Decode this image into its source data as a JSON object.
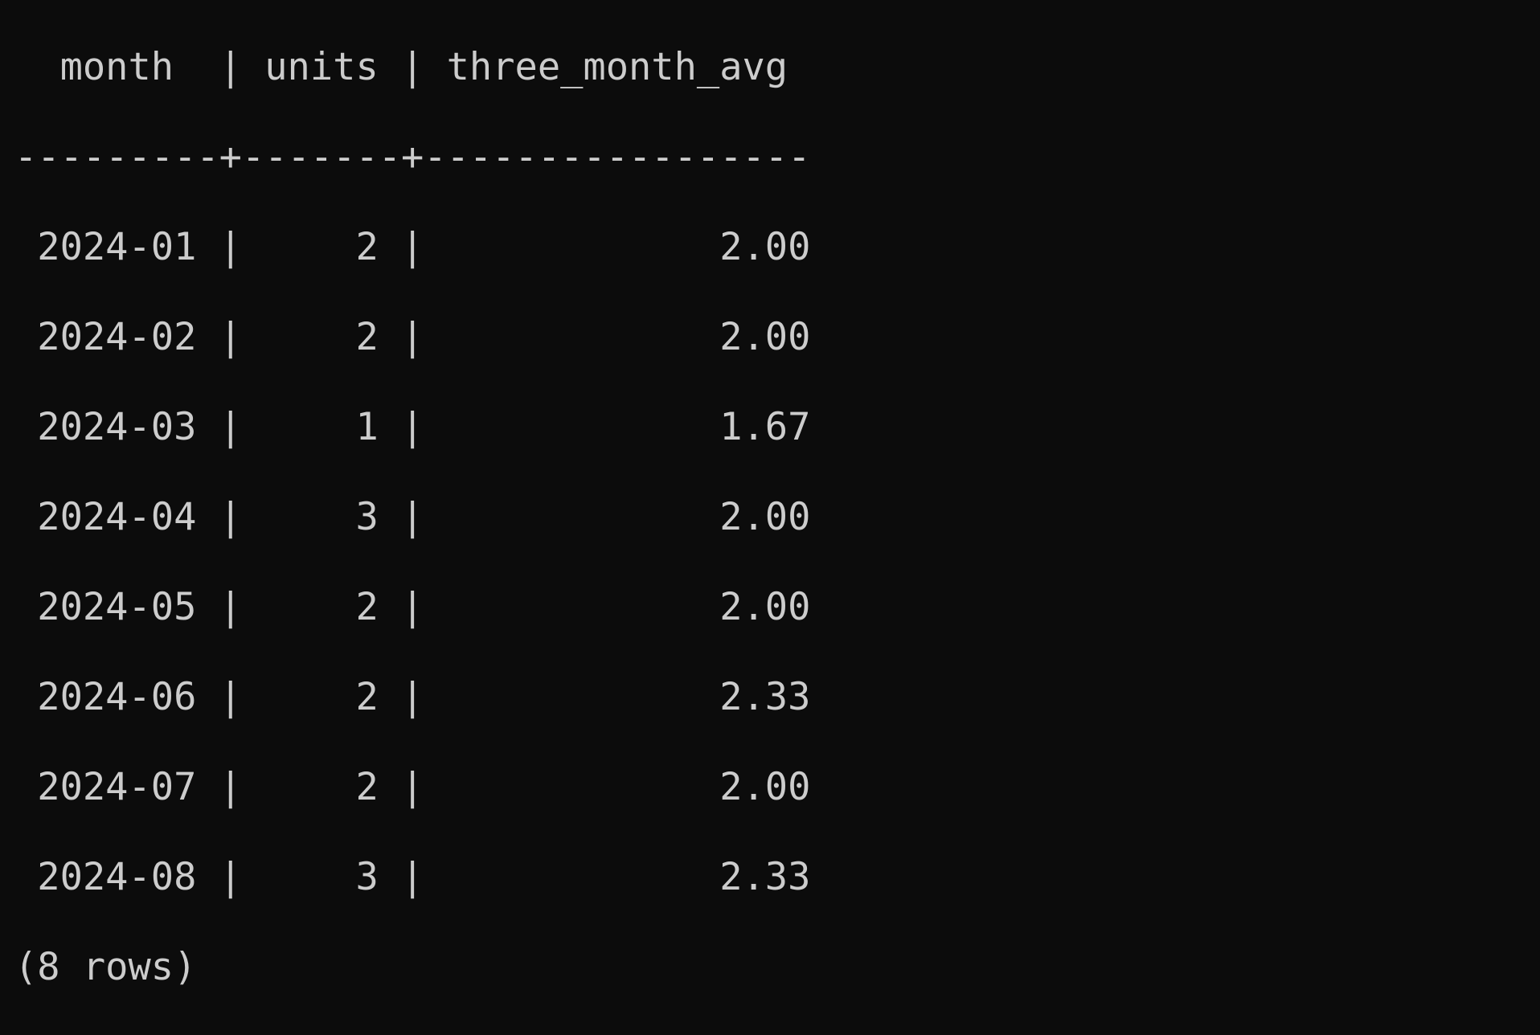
{
  "table": {
    "header": {
      "month": "  month  ",
      "units": " units ",
      "avg": " three_month_avg"
    },
    "divider": "---------+-------+-----------------",
    "rows": [
      {
        "month": " 2024-01 ",
        "units": "     2 ",
        "avg": "             2.00"
      },
      {
        "month": " 2024-02 ",
        "units": "     2 ",
        "avg": "             2.00"
      },
      {
        "month": " 2024-03 ",
        "units": "     1 ",
        "avg": "             1.67"
      },
      {
        "month": " 2024-04 ",
        "units": "     3 ",
        "avg": "             2.00"
      },
      {
        "month": " 2024-05 ",
        "units": "     2 ",
        "avg": "             2.00"
      },
      {
        "month": " 2024-06 ",
        "units": "     2 ",
        "avg": "             2.33"
      },
      {
        "month": " 2024-07 ",
        "units": "     2 ",
        "avg": "             2.00"
      },
      {
        "month": " 2024-08 ",
        "units": "     3 ",
        "avg": "             2.33"
      }
    ],
    "footer": "(8 rows)"
  }
}
